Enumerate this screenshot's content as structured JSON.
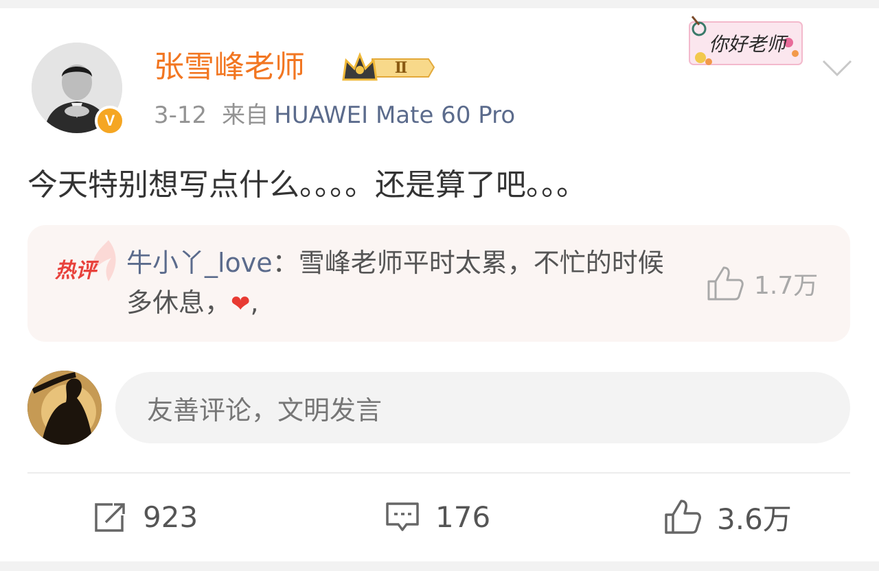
{
  "post": {
    "username": "张雪峰老师",
    "vip_level": "Ⅱ",
    "verified_mark": "V",
    "date": "3-12",
    "source_prefix": "来自",
    "device": "HUAWEI Mate 60 Pro",
    "sticker_text": "你好老师",
    "text": "今天特别想写点什么。。。。还是算了吧。。。"
  },
  "hot_comment": {
    "tag": "热评",
    "user": "牛小丫_love",
    "separator": "：",
    "text": "雪峰老师平时太累，不忙的时候多休息，",
    "emoji": "❤",
    "tail": ",",
    "likes": "1.7万"
  },
  "comment_box": {
    "placeholder": "友善评论，文明发言"
  },
  "actions": {
    "reposts": "923",
    "comments": "176",
    "likes": "3.6万"
  },
  "colors": {
    "username": "#f27621",
    "link": "#5b6b8c",
    "vip_gold": "#f5a623",
    "hot_bg": "#fbf5f3"
  },
  "icons": [
    "verified-v-icon",
    "crown-icon",
    "chevron-down-icon",
    "hot-comment-icon",
    "thumb-up-icon",
    "repost-icon",
    "comment-icon"
  ]
}
